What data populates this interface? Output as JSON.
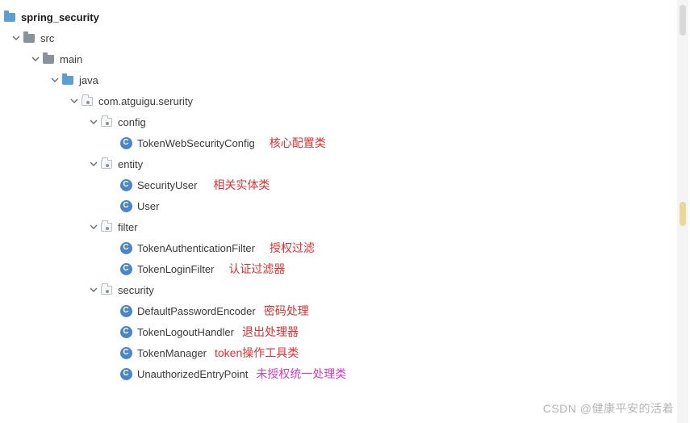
{
  "root": {
    "name": "spring_security"
  },
  "tree": {
    "src": "src",
    "main": "main",
    "java": "java",
    "pkg": "com.atguigu.serurity",
    "config": {
      "label": "config",
      "files": {
        "TokenWebSecurityConfig": "TokenWebSecurityConfig"
      },
      "annotation": "核心配置类"
    },
    "entity": {
      "label": "entity",
      "files": {
        "SecurityUser": "SecurityUser",
        "User": "User"
      },
      "annotation": "相关实体类"
    },
    "filter": {
      "label": "filter",
      "files": {
        "TokenAuthenticationFilter": "TokenAuthenticationFilter",
        "TokenLoginFilter": "TokenLoginFilter"
      },
      "annotation_auth": "授权过滤",
      "annotation_login": "认证过滤器"
    },
    "security": {
      "label": "security",
      "files": {
        "DefaultPasswordEncoder": "DefaultPasswordEncoder",
        "TokenLogoutHandler": "TokenLogoutHandler",
        "TokenManager": "TokenManager",
        "UnauthorizedEntryPoint": "UnauthorizedEntryPoint"
      },
      "annotations": {
        "pwd": "密码处理",
        "logout": "退出处理器",
        "token": "token操作工具类",
        "unauth": "未授权统一处理类"
      }
    }
  },
  "class_icon_letter": "C",
  "watermark": "CSDN @健康平安的活着"
}
